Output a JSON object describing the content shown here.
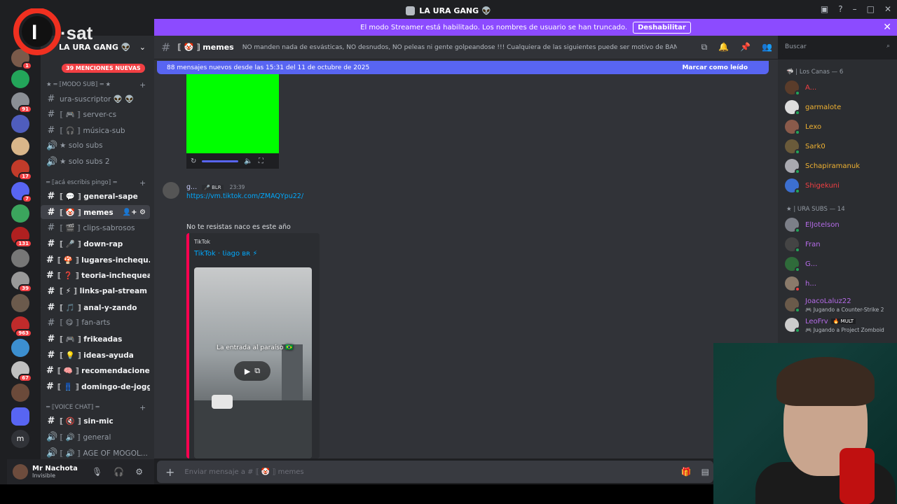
{
  "window": {
    "title": "LA URA GANG 👽"
  },
  "streamer_bar": {
    "text": "El modo Streamer está habilitado. Los nombres de usuario se han truncado.",
    "button": "Deshabilitar",
    "close": "✕"
  },
  "logo_text": "I·sat",
  "server": {
    "name": "LA URA GANG 👽",
    "mentions": "39 MENCIONES NUEVAS"
  },
  "guild_badges": [
    "1",
    "91",
    "17",
    "7",
    "131",
    "39",
    "963",
    "67"
  ],
  "categories": {
    "modo_sub": "★ ═ ⟦MODO SUB⟧ ═ ★",
    "aca": "═ ⟦acá escribis pingo⟧ ═",
    "voice": "═ ⟦VOICE CHAT⟧ ═"
  },
  "channels": {
    "c0": "ura-suscriptor 👽 👽",
    "c1": "⟦ 🎮 ⟧ server-cs",
    "c2": "⟦ 🎧 ⟧ música-sub",
    "c3": "★ solo subs",
    "c4": "★ solo subs 2",
    "c5": "⟦ 💬 ⟧ general-sape",
    "c6": "⟦ 🤡 ⟧ memes",
    "c7": "⟦ 🎬 ⟧ clips-sabrosos",
    "c8": "⟦ 🎤 ⟧ down-rap",
    "c9": "⟦ 🍄 ⟧ lugares-inchequ...",
    "c10": "⟦ ❓ ⟧ teoria-inchequea...",
    "c11": "⟦ ⚡ ⟧ links-pal-stream",
    "c12": "⟦ 🎵 ⟧ anal-y-zando",
    "c13": "⟦ 😋 ⟧ fan-arts",
    "c14": "⟦ 🎮 ⟧ frikeadas",
    "c15": "⟦ 💡 ⟧ ideas-ayuda",
    "c16": "⟦ 🧠 ⟧ recomendaciones",
    "c17": "⟦ 👖 ⟧ domingo-de-joggin",
    "c18": "⟦ 🔇 ⟧ sin-mic",
    "c19": "⟦ 🔊 ⟧ general",
    "c20": "⟦ 🔊 ⟧ AGE OF MOGOL..."
  },
  "user": {
    "name": "Mr Nachota",
    "status": "Invisible"
  },
  "header": {
    "channel": "⟦ 🤡 ⟧ memes",
    "topic": "NO manden nada de esvásticas, NO desnudos, NO peleas ni gente golpeandose !!! Cualquiera de las siguientes puede ser motivo de BAN, cuiden el stream!"
  },
  "search": {
    "placeholder": "Buscar"
  },
  "new_messages": {
    "text": "88 mensajes nuevos desde las 15:31 del 11 de octubre de 2025",
    "mark": "Marcar como leído"
  },
  "message": {
    "author": "g...",
    "tag": "🎤 BLR",
    "time": "23:39",
    "link": "https://vm.tiktok.com/ZMAQYpu22/",
    "text": "No te resistas naco es este año",
    "embed": {
      "provider": "TikTok",
      "title": "TikTok · Ɩiago ʙʀ ⚡",
      "caption": "La entrada al paraíso 🇧🇷"
    }
  },
  "composer": {
    "placeholder": "Enviar mensaje a # ⟦ 🤡 ⟧ memes"
  },
  "members": {
    "cat1": "🦈 | Los Canas — 6",
    "cat2": "★ | URA SUBS — 14",
    "list": [
      {
        "name": "A...",
        "color": "#f23f43"
      },
      {
        "name": "garmalote",
        "color": "#f0b232"
      },
      {
        "name": "Lexo",
        "color": "#f0b232"
      },
      {
        "name": "Sark0",
        "color": "#f0b232"
      },
      {
        "name": "Schapiramanuk",
        "color": "#f0b232"
      },
      {
        "name": "Shigekuni",
        "color": "#f23f43"
      },
      {
        "name": "ElJotelson",
        "color": "#b56be8"
      },
      {
        "name": "Fran",
        "color": "#b56be8"
      },
      {
        "name": "G...",
        "color": "#b56be8"
      },
      {
        "name": "h...",
        "color": "#b56be8"
      },
      {
        "name": "JoacoLaluz22",
        "color": "#b56be8"
      },
      {
        "name": "LeoFrv",
        "color": "#b56be8"
      }
    ],
    "activity_joaco": "🎮 Jugando a Counter-Strike 2",
    "activity_leo": "🎮 Jugando a Project Zomboid",
    "leo_tag": "🔥 MULT"
  }
}
